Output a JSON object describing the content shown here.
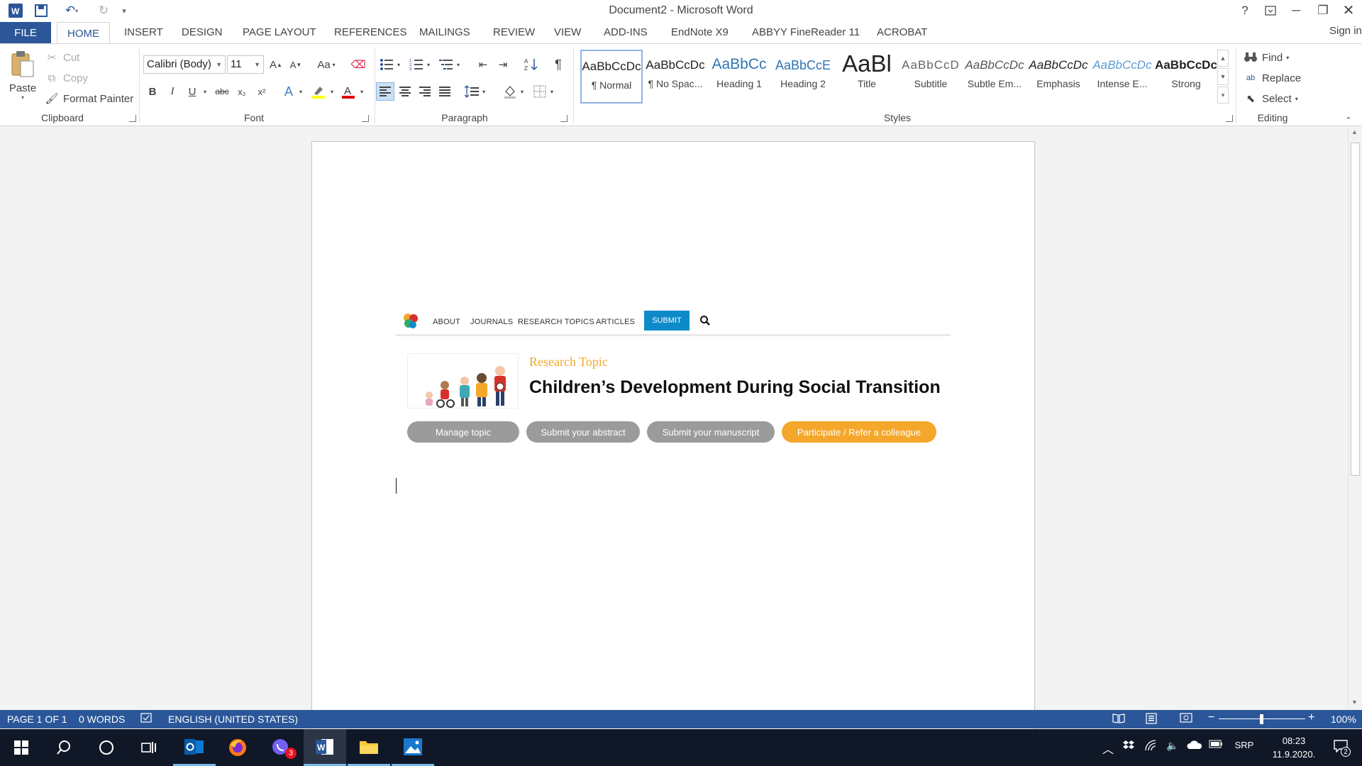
{
  "window": {
    "title": "Document2 - Microsoft Word",
    "sign_in": "Sign in",
    "help": "?"
  },
  "tabs": [
    "FILE",
    "HOME",
    "INSERT",
    "DESIGN",
    "PAGE LAYOUT",
    "REFERENCES",
    "MAILINGS",
    "REVIEW",
    "VIEW",
    "ADD-INS",
    "EndNote X9",
    "ABBYY FineReader 11",
    "ACROBAT"
  ],
  "clipboard": {
    "paste": "Paste",
    "cut": "Cut",
    "copy": "Copy",
    "format_painter": "Format Painter",
    "label": "Clipboard"
  },
  "font": {
    "family": "Calibri (Body)",
    "size": "11",
    "change_case": "Aa",
    "bold": "B",
    "italic": "I",
    "underline": "U",
    "strike": "abc",
    "subscript": "x₂",
    "superscript": "x²",
    "label": "Font"
  },
  "paragraph": {
    "label": "Paragraph"
  },
  "styles": {
    "label": "Styles",
    "items": [
      {
        "sample": "AaBbCcDc",
        "name": "¶ Normal"
      },
      {
        "sample": "AaBbCcDc",
        "name": "¶ No Spac..."
      },
      {
        "sample": "AaBbCc",
        "name": "Heading 1"
      },
      {
        "sample": "AaBbCcE",
        "name": "Heading 2"
      },
      {
        "sample": "AaBl",
        "name": "Title"
      },
      {
        "sample": "AaBbCcD",
        "name": "Subtitle"
      },
      {
        "sample": "AaBbCcDc",
        "name": "Subtle Em..."
      },
      {
        "sample": "AaBbCcDc",
        "name": "Emphasis"
      },
      {
        "sample": "AaBbCcDc",
        "name": "Intense E..."
      },
      {
        "sample": "AaBbCcDc",
        "name": "Strong"
      }
    ]
  },
  "editing": {
    "find": "Find",
    "replace": "Replace",
    "select": "Select",
    "label": "Editing"
  },
  "web": {
    "nav": [
      "ABOUT",
      "JOURNALS",
      "RESEARCH TOPICS",
      "ARTICLES"
    ],
    "submit": "SUBMIT",
    "topic_label": "Research Topic",
    "topic_title": "Children’s Development During Social Transition",
    "buttons": [
      "Manage topic",
      "Submit your abstract",
      "Submit your manuscript",
      "Participate / Refer a colleague"
    ],
    "accent": "#f4a72a",
    "submit_color": "#0e8ac9",
    "pill_gray": "#9b9b9b"
  },
  "status": {
    "page": "PAGE 1 OF 1",
    "words": "0 WORDS",
    "language": "ENGLISH (UNITED STATES)",
    "zoom": "100%",
    "zoom_minus": "−",
    "zoom_plus": "+"
  },
  "taskbar": {
    "lang": "SRP",
    "time": "08:23",
    "date": "11.9.2020.",
    "viber_badge": "3",
    "notif_badge": "2"
  }
}
